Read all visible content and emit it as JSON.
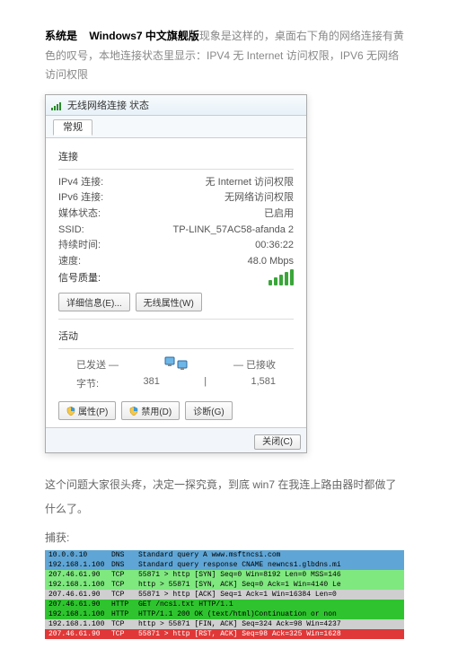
{
  "intro": {
    "prefix_bold": "系统是",
    "os_bold": "Windows7 中文旗舰版",
    "rest_gray": "现象是这样的，桌面右下角的网络连接有黄色的叹号，本地连接状态里显示：IPV4 无 Internet 访问权限，IPV6 无网络访问权限"
  },
  "window": {
    "title": "无线网络连接 状态",
    "tab": "常规",
    "section_conn": "连接",
    "rows": [
      {
        "k": "IPv4 连接:",
        "v": "无 Internet 访问权限"
      },
      {
        "k": "IPv6 连接:",
        "v": "无网络访问权限"
      },
      {
        "k": "媒体状态:",
        "v": "已启用"
      },
      {
        "k": "SSID:",
        "v": "TP-LINK_57AC58-afanda 2"
      },
      {
        "k": "持续时间:",
        "v": "00:36:22"
      },
      {
        "k": "速度:",
        "v": "48.0 Mbps"
      }
    ],
    "signal_quality_label": "信号质量:",
    "buttons_detail": "详细信息(E)...",
    "buttons_wireless": "无线属性(W)",
    "section_activity": "活动",
    "sent": "已发送 —",
    "recv": "— 已接收",
    "bytes_label": "字节:",
    "bytes_sent": "381",
    "bytes_recv": "1,581",
    "btn_props": "属性(P)",
    "btn_disable": "禁用(D)",
    "btn_diag": "诊断(G)",
    "btn_close": "关闭(C)"
  },
  "para1": "这个问题大家很头疼，决定一探究竟，到底 win7 在我连上路由器时都做了什么了。",
  "capture_label": "捕获:",
  "packets": [
    {
      "cls": "row-blue",
      "ip": "10.0.0.10",
      "proto": "DNS",
      "info": "Standard query A www.msftncsi.com"
    },
    {
      "cls": "row-blue",
      "ip": "192.168.1.100",
      "proto": "DNS",
      "info": "Standard query response CNAME newncs1.glbdns.mi"
    },
    {
      "cls": "row-green1",
      "ip": "207.46.61.90",
      "proto": "TCP",
      "info": "55871 > http [SYN] Seq=0 Win=8192 Len=0 MSS=146"
    },
    {
      "cls": "row-green1",
      "ip": "192.168.1.100",
      "proto": "TCP",
      "info": "http > 55871 [SYN, ACK] Seq=0 Ack=1 Win=4140 Le"
    },
    {
      "cls": "row-gray",
      "ip": "207.46.61.90",
      "proto": "TCP",
      "info": "55871 > http [ACK] Seq=1 Ack=1 Win=16384 Len=0"
    },
    {
      "cls": "row-green2",
      "ip": "207.46.61.90",
      "proto": "HTTP",
      "info": "GET /ncsi.txt HTTP/1.1"
    },
    {
      "cls": "row-green2",
      "ip": "192.168.1.100",
      "proto": "HTTP",
      "info": "HTTP/1.1 200 OK (text/html)Continuation or non"
    },
    {
      "cls": "row-gray",
      "ip": "192.168.1.100",
      "proto": "TCP",
      "info": "http > 55871 [FIN, ACK] Seq=324 Ack=98 Win=4237"
    },
    {
      "cls": "row-red",
      "ip": "207.46.61.90",
      "proto": "TCP",
      "info": "55871 > http [RST, ACK] Seq=98 Ack=325 Win=1628"
    }
  ]
}
